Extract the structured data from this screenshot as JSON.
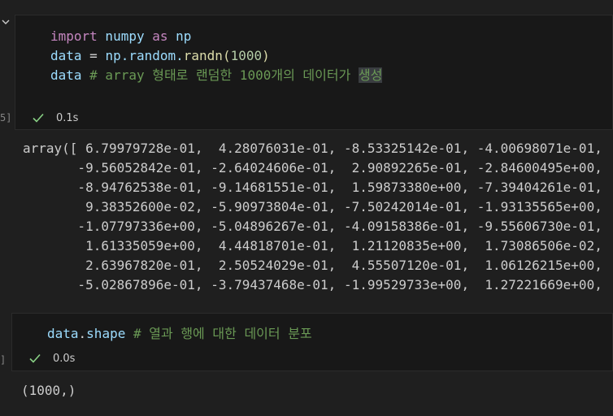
{
  "cell1": {
    "exec_count": "5]",
    "line1": {
      "kw1": "import",
      "mod": " numpy ",
      "kw2": "as",
      "alias": " np"
    },
    "line2": {
      "var": "data",
      "op": " = ",
      "obj": "np.random.",
      "fn": "randn",
      "p1": "(",
      "num": "1000",
      "p2": ")"
    },
    "line3": {
      "var": "data",
      "comment": " # array 형태로 랜덤한 1000개의 데이터가 ",
      "highlight": "생성"
    },
    "time": "0.1s"
  },
  "output1": {
    "lines": [
      "array([ 6.79979728e-01,  4.28076031e-01, -8.53325142e-01, -4.00698071e-01,",
      "       -9.56052842e-01, -2.64024606e-01,  2.90892265e-01, -2.84600495e+00,",
      "       -8.94762538e-01, -9.14681551e-01,  1.59873380e+00, -7.39404261e-01,",
      "        9.38352600e-02, -5.90973804e-01, -7.50242014e-01, -1.93135565e+00,",
      "       -1.07797336e+00, -5.04896267e-01, -4.09158386e-01, -9.55606730e-01,",
      "        1.61335059e+00,  4.44818701e-01,  1.21120835e+00,  1.73086506e-02,",
      "        2.63967820e-01,  2.50524029e-01,  4.55507120e-01,  1.06126215e+00,",
      "       -5.02867896e-01, -3.79437468e-01, -1.99529733e+00,  1.27221669e+00,"
    ]
  },
  "cell2": {
    "exec_count": "]",
    "line1": {
      "var": "data",
      "op": ".",
      "attr": "shape",
      "comment": " # 열과 행에 대한 데이터 분포"
    },
    "time": "0.0s"
  },
  "output2": {
    "text": "(1000,)"
  },
  "colors": {
    "keyword": "#c586c0",
    "variable": "#9cdcfe",
    "function": "#dcdcaa",
    "number": "#b5cea8",
    "comment": "#6a9955",
    "check": "#89d185"
  }
}
